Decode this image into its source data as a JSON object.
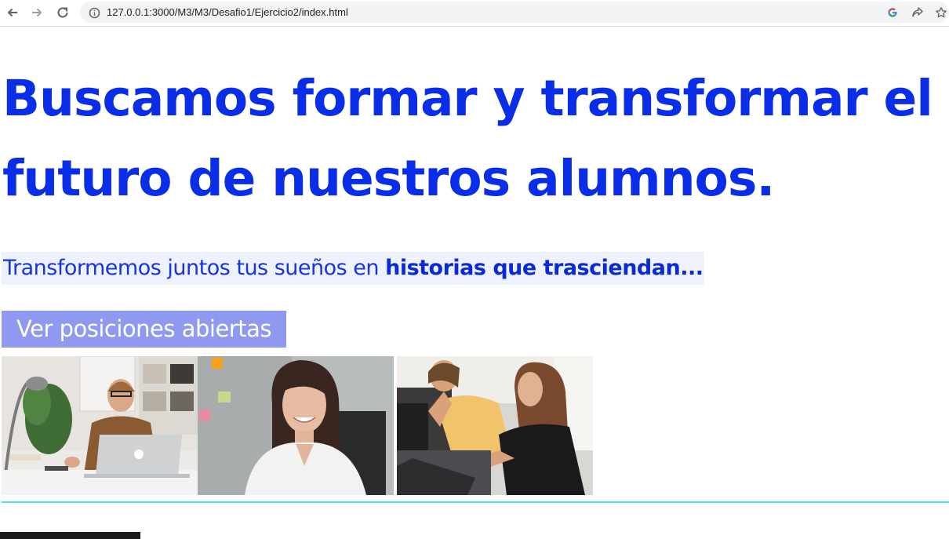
{
  "browser": {
    "url": "127.0.0.1:3000/M3/M3/Desafio1/Ejercicio2/index.html",
    "icons": [
      "back-arrow-icon",
      "forward-arrow-icon",
      "reload-icon",
      "info-icon",
      "google-icon",
      "share-icon",
      "star-icon"
    ]
  },
  "hero": {
    "headline": "Buscamos formar y transformar el futuro de nuestros alumnos.",
    "tagline_regular": "Transformemos juntos tus sueños en ",
    "tagline_bold": "historias que trasciendan...",
    "cta_label": "Ver posiciones abiertas"
  },
  "colors": {
    "headline": "#0a2de8",
    "tagline_bg": "#eef2fd",
    "cta_bg": "#8f99ef",
    "divider": "#44e6ea"
  },
  "gallery": {
    "images": [
      "photo-man-laptop",
      "photo-smiling-woman",
      "photo-two-women-laptop"
    ]
  }
}
